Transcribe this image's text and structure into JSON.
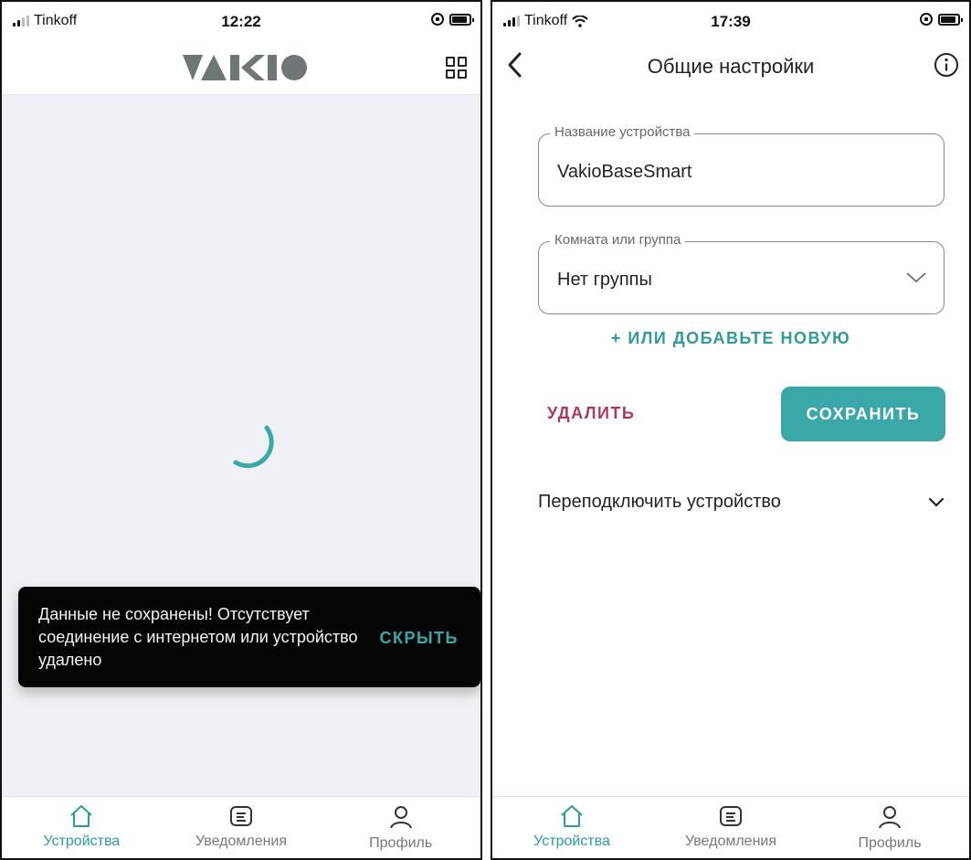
{
  "left_screen": {
    "status_bar": {
      "carrier": "Tinkoff",
      "time": "12:22"
    },
    "header": {
      "logo_text": "VAKIO"
    },
    "snackbar": {
      "message": "Данные не сохранены! Отсутствует соединение с интернетом или устройство удалено",
      "action_label": "СКРЫТЬ"
    }
  },
  "right_screen": {
    "status_bar": {
      "carrier": "Tinkoff",
      "time": "17:39"
    },
    "header": {
      "title": "Общие настройки"
    },
    "device_name_field": {
      "label": "Название устройства",
      "value": "VakioBaseSmart"
    },
    "group_field": {
      "label": "Комната или группа",
      "value": "Нет группы"
    },
    "add_new_label": "+ ИЛИ ДОБАВЬТЕ НОВУЮ",
    "delete_label": "УДАЛИТЬ",
    "save_label": "СОХРАНИТЬ",
    "reconnect_label": "Переподключить устройство"
  },
  "tab_bar": {
    "items": [
      {
        "label": "Устройства",
        "icon": "home-icon",
        "active": true
      },
      {
        "label": "Уведомления",
        "icon": "notifications-icon",
        "active": false
      },
      {
        "label": "Профиль",
        "icon": "profile-icon",
        "active": false
      }
    ]
  },
  "colors": {
    "accent": "#3aa8a8",
    "danger": "#b0365c",
    "background_left": "#f0f1f6"
  }
}
